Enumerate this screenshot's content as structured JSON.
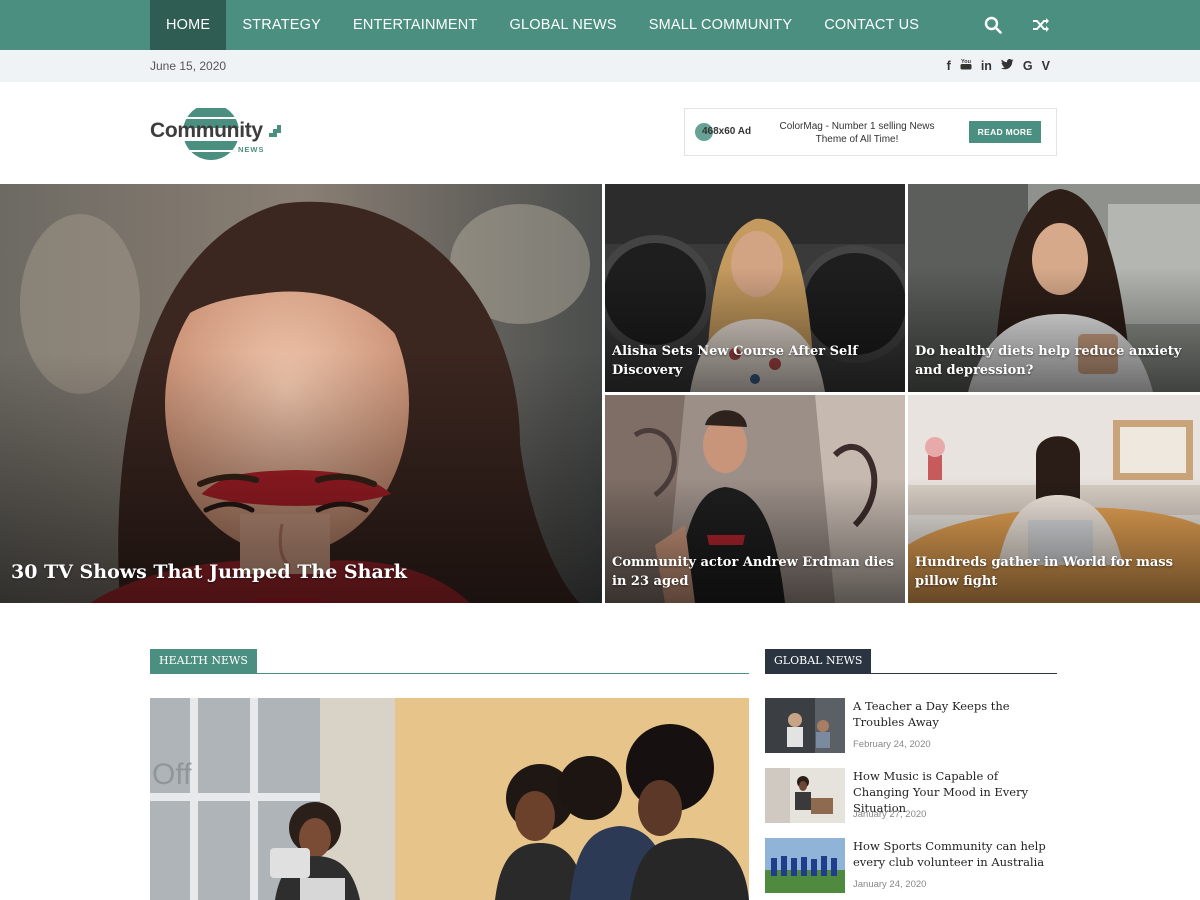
{
  "nav": {
    "items": [
      "HOME",
      "STRATEGY",
      "ENTERTAINMENT",
      "GLOBAL NEWS",
      "SMALL COMMUNITY",
      "CONTACT US"
    ],
    "active": "HOME",
    "search_icon": "search-icon",
    "random_icon": "shuffle-icon",
    "color": "#4b8f80",
    "active_color": "#2f5c53"
  },
  "topbar": {
    "date": "June 15, 2020",
    "social": [
      {
        "name": "facebook-icon",
        "glyph": "f"
      },
      {
        "name": "youtube-icon",
        "glyph": "▶"
      },
      {
        "name": "linkedin-icon",
        "glyph": "in"
      },
      {
        "name": "twitter-icon",
        "glyph": "🐦"
      },
      {
        "name": "google-icon",
        "glyph": "G"
      },
      {
        "name": "vimeo-icon",
        "glyph": "V"
      }
    ]
  },
  "header": {
    "logo_text": "Community",
    "logo_sub": "NEWS",
    "ad": {
      "size_label": "468x60 Ad",
      "text": "ColorMag - Number 1 selling News Theme of All Time!",
      "button": "READ MORE"
    }
  },
  "hero": {
    "main": {
      "caption": "30 TV Shows That Jumped The Shark"
    },
    "tiles": [
      {
        "caption": "Alisha Sets New Course After Self Discovery"
      },
      {
        "caption": "Do healthy diets help reduce anxiety and depression?"
      },
      {
        "caption": "Community actor Andrew Erdman dies in 23 aged"
      },
      {
        "caption": "Hundreds gather in World for mass pillow fight"
      }
    ]
  },
  "health": {
    "title": "HEALTH NEWS",
    "color": "#4b8f80"
  },
  "global": {
    "title": "GLOBAL NEWS",
    "color": "#2b3542",
    "items": [
      {
        "title": "A Teacher a Day Keeps the Troubles Away",
        "date": "February 24, 2020"
      },
      {
        "title": "How Music is Capable of Changing Your Mood in Every Situation",
        "date": "January 27, 2020"
      },
      {
        "title": "How Sports Community can help every club volunteer in Australia",
        "date": "January 24, 2020"
      }
    ]
  }
}
